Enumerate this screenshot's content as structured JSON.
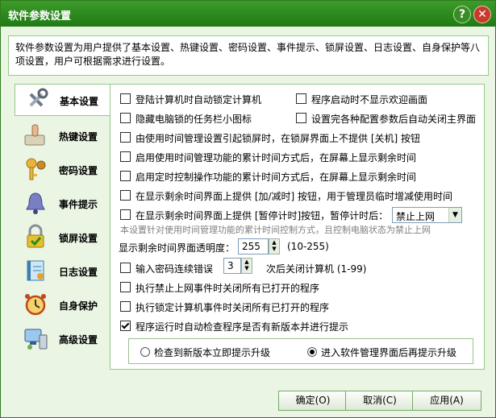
{
  "window": {
    "title": "软件参数设置"
  },
  "titlebar": {
    "help_icon": "help-icon",
    "close_icon": "close-icon"
  },
  "info": {
    "text": "软件参数设置为用户提供了基本设置、热键设置、密码设置、事件提示、锁屏设置、日志设置、自身保护等八项设置，用户可根据需求进行设置。"
  },
  "sidebar": {
    "items": [
      {
        "label": "基本设置",
        "icon": "tools-icon"
      },
      {
        "label": "热键设置",
        "icon": "keyboard-hand-icon"
      },
      {
        "label": "密码设置",
        "icon": "keys-icon"
      },
      {
        "label": "事件提示",
        "icon": "bell-icon"
      },
      {
        "label": "锁屏设置",
        "icon": "lock-icon"
      },
      {
        "label": "日志设置",
        "icon": "log-book-icon"
      },
      {
        "label": "自身保护",
        "icon": "alarm-clock-icon"
      },
      {
        "label": "高级设置",
        "icon": "computer-icon"
      }
    ]
  },
  "options": {
    "login_lock": "登陆计算机时自动锁定计算机",
    "no_welcome": "程序启动时不显示欢迎画面",
    "hide_tray": "隐藏电脑锁的任务栏小图标",
    "auto_close_main": "设置完各种配置参数后自动关闭主界面",
    "no_close_button": "由使用时间管理设置引起锁屏时，在锁屏界面上不提供 [关机] 按钮",
    "show_remaining_cumulative": "启用使用时间管理功能的累计时间方式后，在屏幕上显示剩余时间",
    "show_remaining_timer": "启用定时控制操作功能的累计时间方式后，在屏幕上显示剩余时间",
    "add_reduce_button": "在显示剩余时间界面上提供 [加/减时] 按钮，用于管理员临时增减使用时间",
    "pause_timer_prefix": "在显示剩余时间界面上提供 [暂停计时]按钮，暂停计时后：",
    "pause_timer_select": "禁止上网",
    "pause_timer_note": "本设置针对使用时间管理功能的累计时间控制方式，且控制电脑状态为禁止上网",
    "opacity_label": "显示剩余时间界面透明度：",
    "opacity_value": "255",
    "opacity_range": "(10-255)",
    "password_error_label": "输入密码连续错误",
    "password_error_value": "3",
    "password_error_suffix": "次后关闭计算机 (1-99)",
    "close_on_block": "执行禁止上网事件时关闭所有已打开的程序",
    "close_on_lock": "执行锁定计算机事件时关闭所有已打开的程序",
    "auto_check_update": "程序运行时自动检查程序是否有新版本并进行提示",
    "update_immediate": "检查到新版本立即提示升级",
    "update_after_manage": "进入软件管理界面后再提示升级"
  },
  "buttons": {
    "ok": "确定(O)",
    "cancel": "取消(C)",
    "apply": "应用(A)"
  }
}
